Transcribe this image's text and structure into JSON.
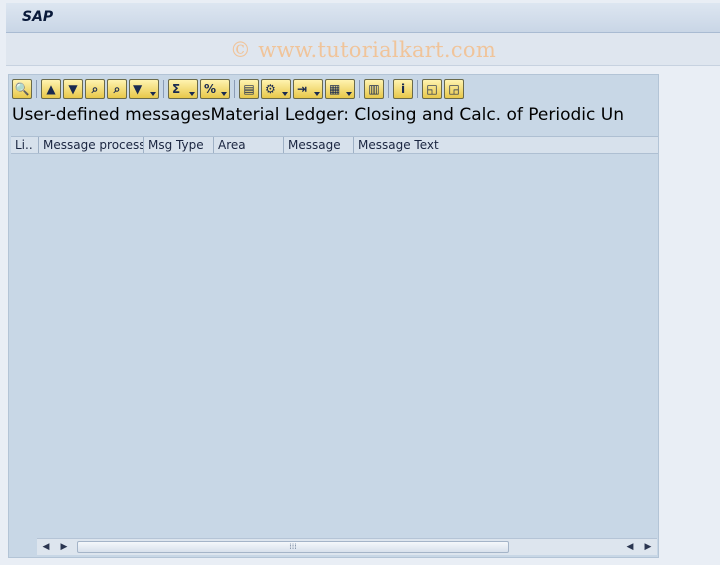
{
  "header": {
    "brand": "SAP",
    "watermark": "© www.tutorialkart.com"
  },
  "toolbar": {
    "buttons": [
      {
        "name": "details-icon",
        "glyph": "🔍"
      },
      {
        "name": "sort-ascending-icon",
        "glyph": "▲"
      },
      {
        "name": "sort-descending-icon",
        "glyph": "▼"
      },
      {
        "name": "find-icon",
        "glyph": "⌕"
      },
      {
        "name": "find-next-icon",
        "glyph": "⌕"
      },
      {
        "name": "filter-icon",
        "glyph": "▼"
      },
      {
        "name": "total-icon",
        "glyph": "Σ"
      },
      {
        "name": "subtotal-icon",
        "glyph": "%"
      },
      {
        "name": "print-preview-icon",
        "glyph": "▤"
      },
      {
        "name": "export-icon",
        "glyph": "⚙"
      },
      {
        "name": "export-file-icon",
        "glyph": "⇥"
      },
      {
        "name": "change-layout-icon",
        "glyph": "▦"
      },
      {
        "name": "graphic-icon",
        "glyph": "▥"
      },
      {
        "name": "information-icon",
        "glyph": "i"
      },
      {
        "name": "new-window-icon",
        "glyph": "◱"
      },
      {
        "name": "copy-window-icon",
        "glyph": "◲"
      }
    ]
  },
  "list": {
    "title": "User-defined messagesMaterial Ledger: Closing and Calc. of Periodic Un",
    "columns": [
      "Li..",
      "Message process...",
      "Msg Type",
      "Area",
      "Message",
      "Message Text"
    ]
  },
  "colors": {
    "accent": "#1a2a50",
    "panel": "#c8d7e6",
    "watermark": "#f0c49a"
  }
}
